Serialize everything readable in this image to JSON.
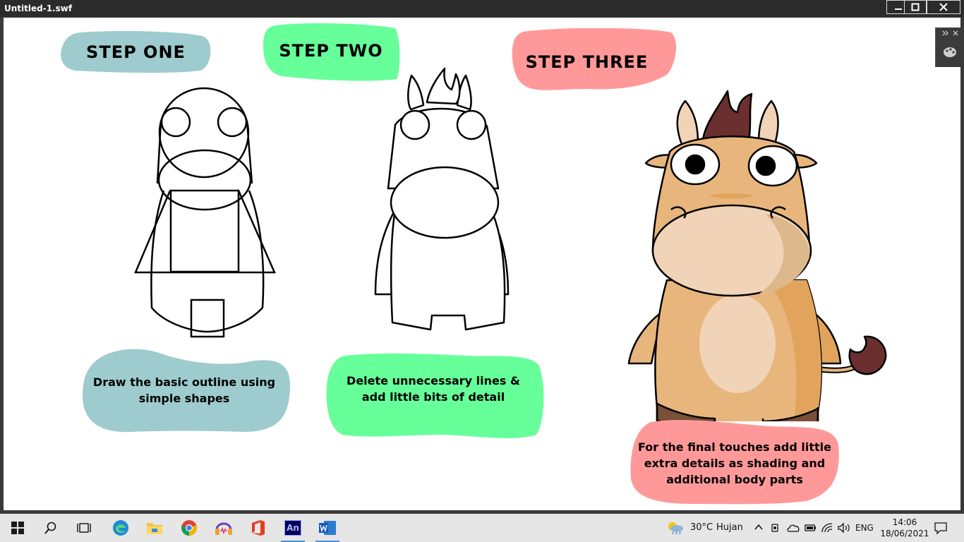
{
  "window": {
    "title": "Untitled-1.swf"
  },
  "steps": [
    {
      "heading": "STEP ONE",
      "caption": "Draw the basic outline using simple shapes"
    },
    {
      "heading": "STEP TWO",
      "caption": "Delete unnecessary lines & add little bits of detail"
    },
    {
      "heading": "STEP THREE",
      "caption": "For the final touches add little extra details as shading and additional body parts"
    }
  ],
  "colors": {
    "step_one": "#9ecbcd",
    "step_two": "#66ff99",
    "step_three": "#ff9999",
    "cow_body": "#e8b67c",
    "cow_shade": "#e2a45d",
    "cow_muzzle": "#f1d4b8",
    "cow_hair": "#6b2f2f",
    "cow_hoof": "#7a5036"
  },
  "taskbar": {
    "icons": [
      "windows-start-icon",
      "search-icon",
      "task-view-icon",
      "edge-icon",
      "file-explorer-icon",
      "chrome-icon",
      "headphones-app-icon",
      "office-icon",
      "animate-icon",
      "word-icon"
    ],
    "animate_label": "An",
    "weather_temp": "30°C",
    "weather_desc": "Hujan",
    "language": "ENG",
    "time": "14:06",
    "date": "18/06/2021"
  }
}
